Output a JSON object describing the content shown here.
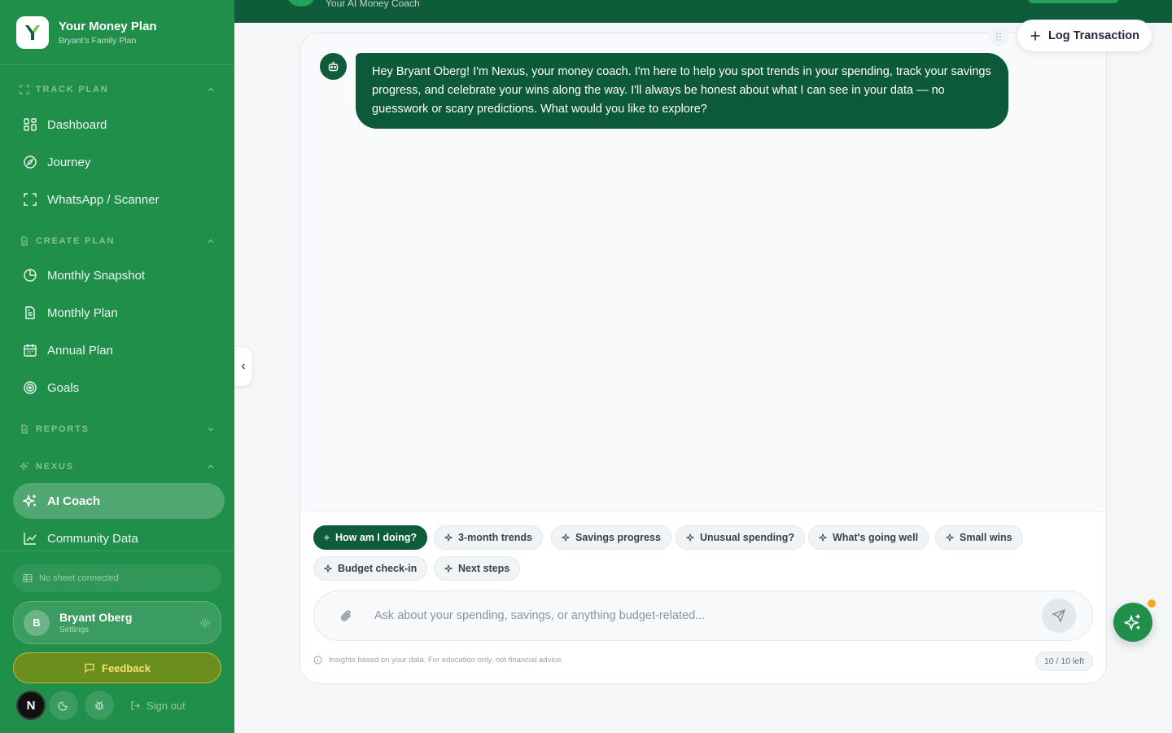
{
  "brand": {
    "title": "Your Money Plan",
    "subtitle": "Bryant's Family Plan"
  },
  "header": {
    "subtitle": "Your AI Money Coach"
  },
  "sidebar": {
    "sections": [
      {
        "label": "TRACK PLAN",
        "icon": "scan-icon",
        "expanded": true
      },
      {
        "label": "CREATE PLAN",
        "icon": "file-icon",
        "expanded": true
      },
      {
        "label": "REPORTS",
        "icon": "file-icon",
        "expanded": false
      },
      {
        "label": "NEXUS",
        "icon": "sparkles-icon",
        "expanded": true
      }
    ],
    "items": [
      {
        "label": "Dashboard",
        "icon": "grid-icon"
      },
      {
        "label": "Journey",
        "icon": "compass-icon"
      },
      {
        "label": "WhatsApp / Scanner",
        "icon": "scan-icon"
      },
      {
        "label": "Monthly Snapshot",
        "icon": "pie-chart-icon"
      },
      {
        "label": "Monthly Plan",
        "icon": "document-icon"
      },
      {
        "label": "Annual Plan",
        "icon": "calendar-icon"
      },
      {
        "label": "Goals",
        "icon": "target-icon"
      },
      {
        "label": "AI Coach",
        "icon": "sparkles-icon",
        "active": true
      },
      {
        "label": "Community Data",
        "icon": "line-chart-icon"
      }
    ],
    "sheet_status": "No sheet connected",
    "user": {
      "initial": "B",
      "name": "Bryant Oberg",
      "subtitle": "Settings"
    },
    "feedback_label": "Feedback",
    "n_button": "N",
    "signout_label": "Sign out"
  },
  "toolbar": {
    "log_transaction_label": "Log Transaction"
  },
  "chat": {
    "messages": [
      {
        "role": "assistant",
        "text": "Hey Bryant Oberg! I'm Nexus, your money coach. I'm here to help you spot trends in your spending, track your savings progress, and celebrate your wins along the way. I'll always be honest about what I can see in your data — no guesswork or scary predictions. What would you like to explore?"
      }
    ],
    "suggestions": [
      {
        "label": "How am I doing?",
        "active": true
      },
      {
        "label": "3-month trends"
      },
      {
        "label": "Savings progress"
      },
      {
        "label": "Unusual spending?"
      },
      {
        "label": "What's going well"
      },
      {
        "label": "Small wins"
      },
      {
        "label": "Budget check-in"
      },
      {
        "label": "Next steps"
      }
    ],
    "input_placeholder": "Ask about your spending, savings, or anything budget-related...",
    "input_value": "",
    "disclaimer": "Insights based on your data. For education only, not financial advice.",
    "quota": "10 / 10 left"
  },
  "colors": {
    "sidebar": "#1f8f4a",
    "brand_dark": "#0f5c3b",
    "accent_orange": "#f5a623",
    "feedback_text": "#f5e36a"
  }
}
